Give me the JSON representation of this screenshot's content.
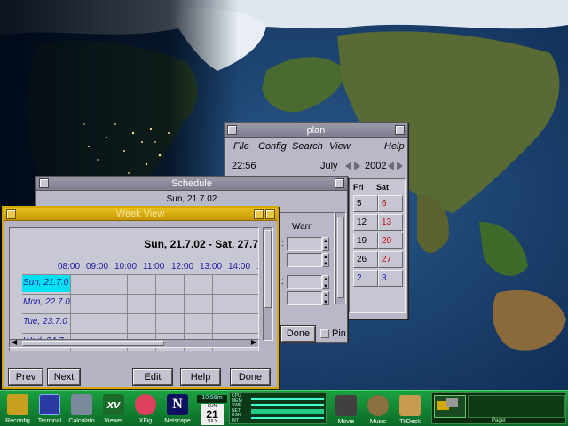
{
  "plan_window": {
    "title": "plan",
    "menu": [
      "File",
      "Config",
      "Search",
      "View",
      "Help"
    ],
    "time": "22:56",
    "month": "July",
    "year": "2002",
    "calendar": {
      "headers": [
        "Fri",
        "Sat"
      ],
      "rows": [
        [
          "5",
          "6"
        ],
        [
          "12",
          "13"
        ],
        [
          "19",
          "20"
        ],
        [
          "26",
          "27"
        ],
        [
          "2",
          "3"
        ]
      ]
    }
  },
  "schedule_window": {
    "title": "Schedule",
    "date": "Sun, 21.7.02",
    "warn_header": "Warn",
    "done_label": "Done",
    "pin_label": "Pin"
  },
  "week_window": {
    "title": "Week View",
    "range": "Sun, 21.7.02 - Sat, 27.7",
    "hours": [
      "08:00",
      "09:00",
      "10:00",
      "11:00",
      "12:00",
      "13:00",
      "14:00",
      "1"
    ],
    "days": [
      "Sun, 21.7.0",
      "Mon, 22.7.0",
      "Tue, 23.7.0",
      "Wed, 24.7"
    ],
    "buttons": {
      "prev": "Prev",
      "next": "Next",
      "edit": "Edit",
      "help": "Help",
      "done": "Done"
    }
  },
  "taskbar": {
    "apps": [
      "Reconfig",
      "Terminal",
      "Calculato",
      "Viewer",
      "XFig",
      "Netscape"
    ],
    "clock": {
      "time": "10:56m",
      "weekday": "SUN",
      "day": "21",
      "month": "JULY"
    },
    "sysmon_labels": [
      "CPU",
      "MEM",
      "SWP",
      "NET",
      "DSK",
      "INT"
    ],
    "apps_right": [
      "Movie",
      "Music",
      "TkDesk"
    ],
    "pager_label": "Pager"
  },
  "colors": {
    "window_bg": "#b8b8c8",
    "week_border": "#d4a800",
    "taskbar": "#1aa040",
    "selected_day": "#00e0f0",
    "weekend_red": "#c00000",
    "next_month_blue": "#2020c0"
  }
}
